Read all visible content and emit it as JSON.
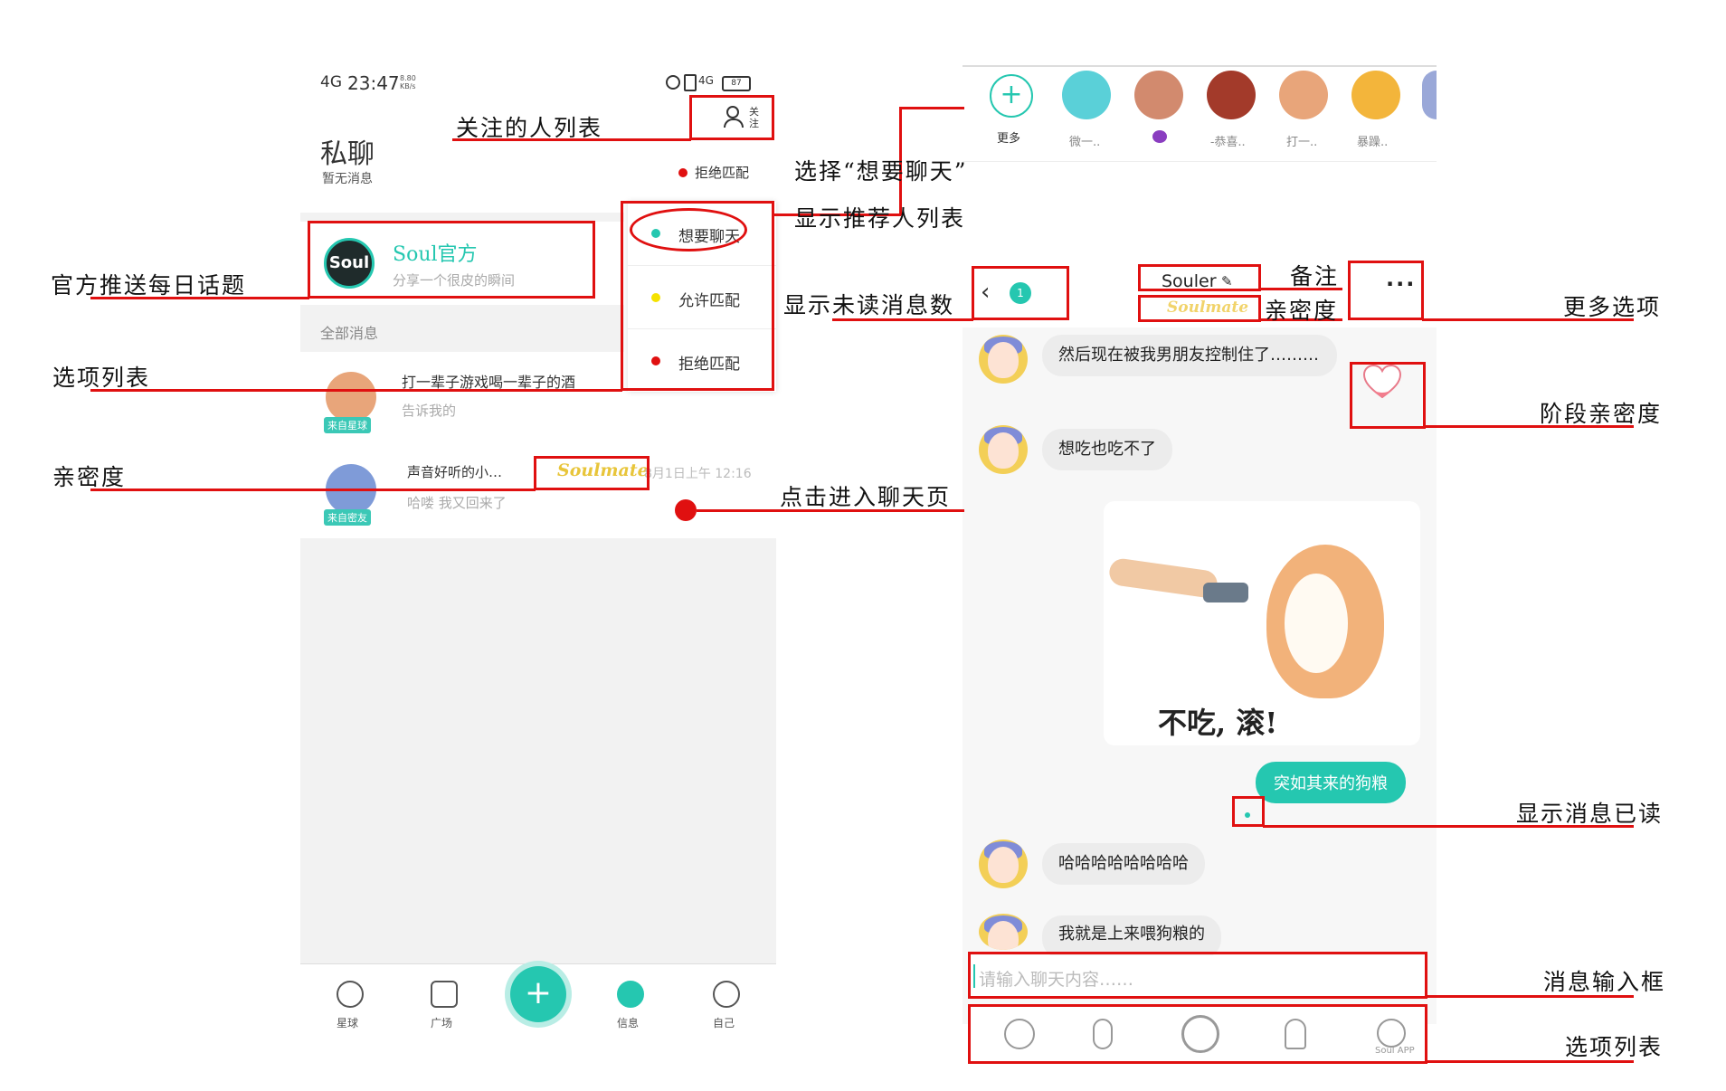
{
  "annotations": {
    "following_list": "关注的人列表",
    "official_push": "官方推送每日话题",
    "option_list_left": "选项列表",
    "intimacy_left": "亲密度",
    "choose_want_chat": "选择“想要聊天”",
    "show_recommend": "显示推荐人列表",
    "show_unread": "显示未读消息数",
    "enter_chat": "点击进入聊天页",
    "remark": "备注",
    "intimacy_right": "亲密度",
    "more_options": "更多选项",
    "stage_intimacy": "阶段亲密度",
    "read_receipt": "显示消息已读",
    "message_input": "消息输入框",
    "option_list_right": "选项列表"
  },
  "left_phone": {
    "status": {
      "signal": "4G",
      "time": "23:47",
      "speed": "8.80 KB/s",
      "battery": "87"
    },
    "follow_label": "关注",
    "page_title": "私聊",
    "page_subtitle": "暂无消息",
    "match_status": "拒绝匹配",
    "official": {
      "name": "Soul官方",
      "subtitle": "分享一个很皮的瞬间",
      "logo": "Soul"
    },
    "section_label": "全部消息",
    "dropdown": [
      {
        "label": "想要聊天",
        "color": "#25c7b0"
      },
      {
        "label": "允许匹配",
        "color": "#f5e200"
      },
      {
        "label": "拒绝匹配",
        "color": "#e01010"
      }
    ],
    "conversations": [
      {
        "title": "打一辈子游戏喝一辈子的酒",
        "preview": "告诉我的",
        "tag": "来自星球"
      },
      {
        "title": "声音好听的小…",
        "preview": "哈喽 我又回来了",
        "tag": "来自密友",
        "badge": "Soulmate",
        "time": "8月1日上午 12:16"
      }
    ],
    "nav": [
      "星球",
      "广场",
      "",
      "信息",
      "自己"
    ]
  },
  "right_phone": {
    "top_avatars": [
      {
        "label": "更多",
        "icon": "plus-icon"
      },
      {
        "label": "微一..",
        "color": "#5ad0d8"
      },
      {
        "label": "",
        "color": "#d28a6e",
        "icon": "devil-icon"
      },
      {
        "label": "-恭喜..",
        "color": "#a33a2a"
      },
      {
        "label": "打一..",
        "color": "#e8a57a"
      },
      {
        "label": "暴躁..",
        "color": "#f3b53b"
      }
    ],
    "unread_count": "1",
    "remark_name": "Souler",
    "intimacy_badge": "Soulmate",
    "messages": [
      {
        "from": "other",
        "text": "然后现在被我男朋友控制住了………"
      },
      {
        "from": "other",
        "text": "想吃也吃不了"
      },
      {
        "from": "other",
        "type": "sticker",
        "caption": "不吃, 滚!"
      },
      {
        "from": "me",
        "text": "突如其来的狗粮"
      },
      {
        "from": "other",
        "text": "哈哈哈哈哈哈哈哈"
      },
      {
        "from": "other",
        "text": "我就是上来喂狗粮的"
      }
    ],
    "input_placeholder": "请输入聊天内容……",
    "watermark": "Soul APP",
    "toolbar_icons": [
      "emoji-icon",
      "voice-icon",
      "record-icon",
      "mic-icon",
      "face-icon"
    ]
  }
}
